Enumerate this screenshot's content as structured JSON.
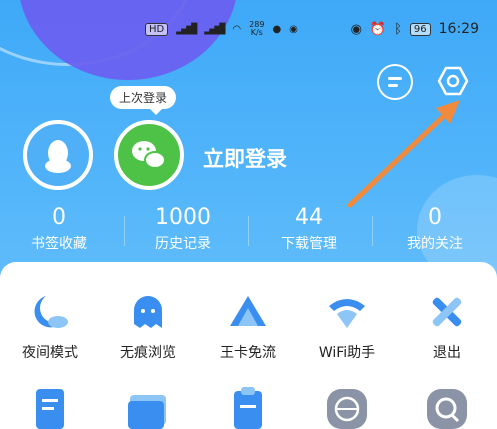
{
  "status_bar": {
    "network_label": "HD",
    "speed": "289",
    "speed_unit": "K/s",
    "battery": "96",
    "time": "16:29"
  },
  "header": {
    "last_login_tag": "上次登录",
    "login_label": "立即登录"
  },
  "stats": [
    {
      "value": "0",
      "label": "书签收藏"
    },
    {
      "value": "1000",
      "label": "历史记录"
    },
    {
      "value": "44",
      "label": "下载管理"
    },
    {
      "value": "0",
      "label": "我的关注"
    }
  ],
  "tools_row1": [
    {
      "label": "夜间模式",
      "icon": "moon-icon"
    },
    {
      "label": "无痕浏览",
      "icon": "ghost-icon"
    },
    {
      "label": "王卡免流",
      "icon": "triangle-card-icon"
    },
    {
      "label": "WiFi助手",
      "icon": "wifi-icon"
    },
    {
      "label": "退出",
      "icon": "exit-x-icon"
    }
  ],
  "tools_row2": [
    {
      "icon": "note-icon"
    },
    {
      "icon": "tickets-icon"
    },
    {
      "icon": "clipboard-icon"
    },
    {
      "icon": "globe-icon"
    },
    {
      "icon": "search-icon"
    }
  ],
  "colors": {
    "header_blue": "#3fa9f8",
    "wechat_green": "#4dc246",
    "icon_blue": "#3a8ef0",
    "arrow_orange": "#f08a3c"
  }
}
